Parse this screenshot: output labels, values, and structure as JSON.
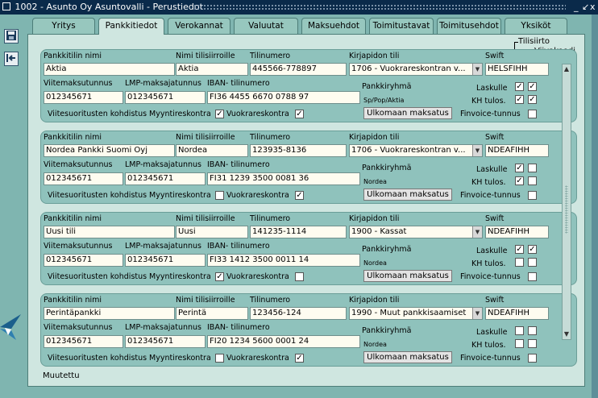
{
  "window": {
    "title": "1002 - Asunto Oy Asuntovalli - Perustiedot",
    "controls": [
      "_",
      "↙",
      "x"
    ]
  },
  "tabs": [
    {
      "label": "Yritys",
      "active": false
    },
    {
      "label": "Pankkitiedot",
      "active": true
    },
    {
      "label": "Verokannat",
      "active": false
    },
    {
      "label": "Valuutat",
      "active": false
    },
    {
      "label": "Maksuehdot",
      "active": false
    },
    {
      "label": "Toimitustavat",
      "active": false
    },
    {
      "label": "Toimitusehdot",
      "active": false
    },
    {
      "label": "Yksiköt",
      "active": false
    }
  ],
  "legend": {
    "tilisiirto": "Tilisiirto",
    "viivakoodi": "Viivakoodi"
  },
  "labels": {
    "bank_name": "Pankkitilin nimi",
    "name_for_transfers": "Nimi tilisiirroille",
    "account_number": "Tilinumero",
    "ledger_account": "Kirjapidon tili",
    "swift": "Swift",
    "reference_id": "Viitemaksutunnus",
    "lmp_id": "LMP-maksajatunnus",
    "iban": "IBAN- tilinumero",
    "bank_group": "Pankkiryhmä",
    "laskulle": "Laskulle",
    "kh_tulos": "KH tulos.",
    "finvoice": "Finvoice-tunnus",
    "ref_allocation": "Viitesuoritusten kohdistus",
    "myyntireskontra": "Myyntireskontra",
    "vuokrareskontra": "Vuokrareskontra",
    "foreign_payment": "Ulkomaan maksatus"
  },
  "accounts": [
    {
      "name": "Aktia",
      "transfer_name": "Aktia",
      "account_number": "445566-778897",
      "ledger": "1706 - Vuokrareskontran v...",
      "swift": "HELSFIHH",
      "reference_id": "012345671",
      "lmp_id": "012345671",
      "iban": "FI36 4455 6670 0788 97",
      "bank_group": "Sp/Pop/Aktia",
      "laskulle_tilisiirto": true,
      "laskulle_viivakoodi": true,
      "kh_tilisiirto": true,
      "kh_viivakoodi": true,
      "myyntireskontra": true,
      "vuokrareskontra": true,
      "finvoice": false
    },
    {
      "name": "Nordea Pankki Suomi Oyj",
      "transfer_name": "Nordea",
      "account_number": "123935-8136",
      "ledger": "1706 - Vuokrareskontran v...",
      "swift": "NDEAFIHH",
      "reference_id": "012345671",
      "lmp_id": "012345671",
      "iban": "FI31 1239 3500 0081 36",
      "bank_group": "Nordea",
      "laskulle_tilisiirto": true,
      "laskulle_viivakoodi": false,
      "kh_tilisiirto": true,
      "kh_viivakoodi": false,
      "myyntireskontra": false,
      "vuokrareskontra": true,
      "finvoice": false
    },
    {
      "name": "Uusi tili",
      "transfer_name": "Uusi",
      "account_number": "141235-1114",
      "ledger": "1900 - Kassat",
      "swift": "NDEAFIHH",
      "reference_id": "012345671",
      "lmp_id": "012345671",
      "iban": "FI33 1412 3500 0011 14",
      "bank_group": "Nordea",
      "laskulle_tilisiirto": true,
      "laskulle_viivakoodi": true,
      "kh_tilisiirto": false,
      "kh_viivakoodi": false,
      "myyntireskontra": true,
      "vuokrareskontra": false,
      "finvoice": false
    },
    {
      "name": "Perintäpankki",
      "transfer_name": "Perintä",
      "account_number": "123456-124",
      "ledger": "1990 - Muut pankkisaamiset",
      "swift": "NDEAFIHH",
      "reference_id": "012345671",
      "lmp_id": "012345671",
      "iban": "FI20 1234 5600 0001 24",
      "bank_group": "Nordea",
      "laskulle_tilisiirto": false,
      "laskulle_viivakoodi": false,
      "kh_tilisiirto": false,
      "kh_viivakoodi": false,
      "myyntireskontra": false,
      "vuokrareskontra": true,
      "finvoice": false
    }
  ],
  "status": "Muutettu",
  "icons": {
    "save": "save-icon",
    "exit": "exit-icon",
    "logo": "app-logo-icon"
  }
}
